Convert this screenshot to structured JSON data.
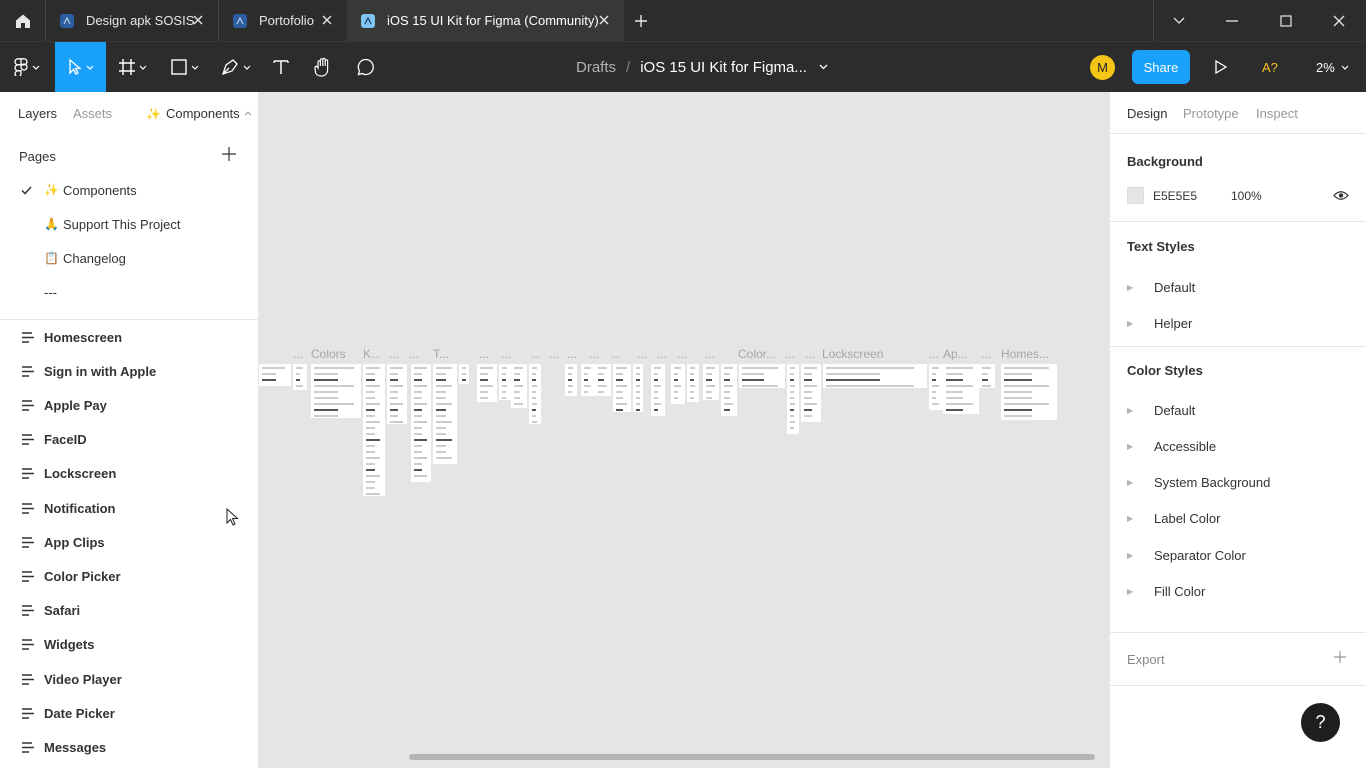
{
  "tabs": [
    {
      "label": "Design apk SOSIS"
    },
    {
      "label": "Portofolio"
    },
    {
      "label": "iOS 15 UI Kit for Figma (Community)"
    }
  ],
  "toolbar": {
    "breadcrumb_parent": "Drafts",
    "breadcrumb_sep": "/",
    "file_name": "iOS 15 UI Kit for Figma...",
    "avatar_initial": "M",
    "share_label": "Share",
    "a_label": "A?",
    "zoom": "2%"
  },
  "left_panel": {
    "tabs": {
      "layers": "Layers",
      "assets": "Assets",
      "page_selector": "Components"
    },
    "pages_heading": "Pages",
    "pages": [
      {
        "label": "Components",
        "icon": "✨",
        "selected": true
      },
      {
        "label": "Support This Project",
        "icon": "🙏",
        "selected": false
      },
      {
        "label": "Changelog",
        "icon": "📋",
        "selected": false
      },
      {
        "label": "---",
        "icon": "",
        "selected": false
      }
    ],
    "layers": [
      "Homescreen",
      "Sign in with Apple",
      "Apple Pay",
      "FaceID",
      "Lockscreen",
      "Notification",
      "App Clips",
      "Color Picker",
      "Safari",
      "Widgets",
      "Video Player",
      "Date Picker",
      "Messages"
    ]
  },
  "canvas": {
    "frame_labels": [
      "...",
      "Colors",
      "K...",
      "...",
      "...",
      "T...",
      "...",
      "...",
      "...",
      "...",
      "...",
      "...",
      "...",
      "...",
      "...",
      "...",
      "...",
      "Color...",
      "...",
      "...",
      "Lockscreen",
      "...",
      "Ap...",
      "...",
      "Homes..."
    ]
  },
  "right_panel": {
    "tabs": {
      "design": "Design",
      "prototype": "Prototype",
      "inspect": "Inspect"
    },
    "background": {
      "heading": "Background",
      "hex": "E5E5E5",
      "opacity": "100%",
      "color": "#e5e5e5"
    },
    "text_styles": {
      "heading": "Text Styles",
      "items": [
        "Default",
        "Helper"
      ]
    },
    "color_styles": {
      "heading": "Color Styles",
      "items": [
        "Default",
        "Accessible",
        "System Background",
        "Label Color",
        "Separator Color",
        "Fill Color"
      ]
    },
    "export": {
      "heading": "Export"
    }
  },
  "help": "?",
  "colors": {
    "accent": "#18a0fb",
    "toolbar_bg": "#2c2c2c",
    "canvas_bg": "#e5e5e5",
    "avatar": "#f5c518"
  }
}
